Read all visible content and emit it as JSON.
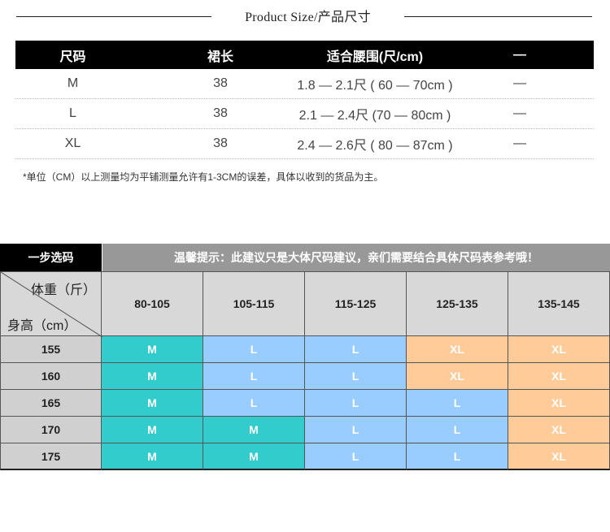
{
  "title": "Product Size/产品尺寸",
  "size_table": {
    "headers": [
      "尺码",
      "裙长",
      "适合腰围(尺/cm)",
      "—"
    ],
    "rows": [
      [
        "M",
        "38",
        "1.8 — 2.1尺 ( 60 — 70cm )",
        "—"
      ],
      [
        "L",
        "38",
        "2.1 — 2.4尺 (70 — 80cm )",
        "—"
      ],
      [
        "XL",
        "38",
        "2.4 — 2.6尺 ( 80 — 87cm )",
        "—"
      ]
    ]
  },
  "note": "*单位（CM）以上测量均为平铺测量允许有1-3CM的误差，具体以收到的货品为主。",
  "recommend": {
    "tag": "一步选码",
    "tip": "温馨提示：此建议只是大体尺码建议，亲们需要结合具体尺码表参考哦！",
    "weight_label": "体重（斤）",
    "height_label": "身高（cm）",
    "weights": [
      "80-105",
      "105-115",
      "115-125",
      "125-135",
      "135-145"
    ],
    "rows": [
      {
        "height": "155",
        "sizes": [
          "M",
          "L",
          "L",
          "XL",
          "XL"
        ]
      },
      {
        "height": "160",
        "sizes": [
          "M",
          "L",
          "L",
          "XL",
          "XL"
        ]
      },
      {
        "height": "165",
        "sizes": [
          "M",
          "L",
          "L",
          "L",
          "XL"
        ]
      },
      {
        "height": "170",
        "sizes": [
          "M",
          "M",
          "L",
          "L",
          "XL"
        ]
      },
      {
        "height": "175",
        "sizes": [
          "M",
          "M",
          "L",
          "L",
          "XL"
        ]
      }
    ],
    "colors": {
      "M": "#33cccc",
      "L": "#99ccff",
      "XL": "#ffcc99"
    }
  }
}
